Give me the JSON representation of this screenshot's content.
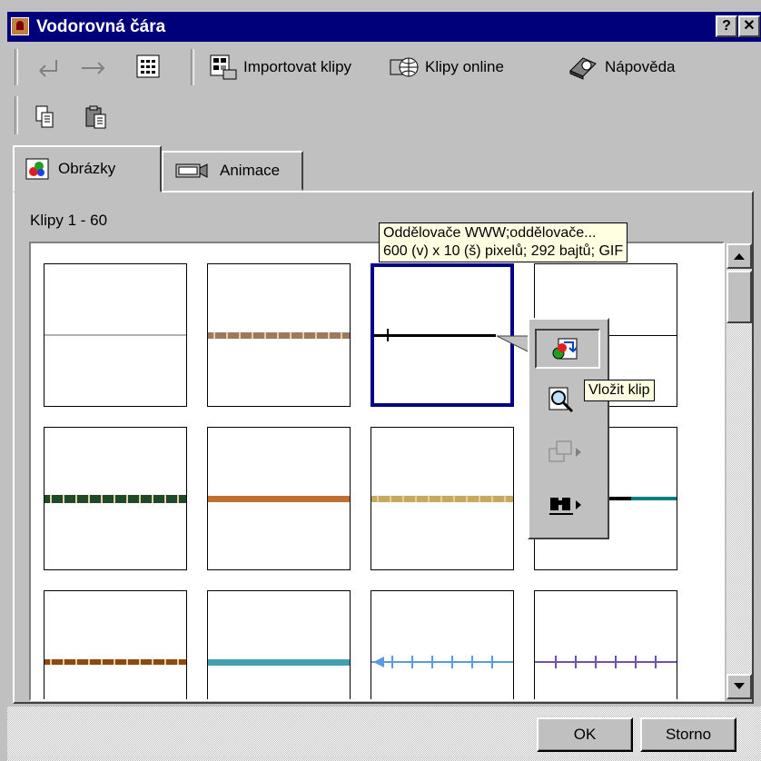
{
  "window": {
    "title": "Vodorovná čára",
    "help_btn": "?",
    "close_btn": "✕"
  },
  "toolbar": {
    "back_icon": "back-arrow-icon",
    "forward_icon": "forward-arrow-icon",
    "import_label": "Importovat klipy",
    "online_label": "Klipy online",
    "help_label": "Nápověda"
  },
  "tabs": [
    {
      "label": "Obrázky",
      "icon": "pictures-icon",
      "active": true
    },
    {
      "label": "Animace",
      "icon": "camera-icon",
      "active": false
    }
  ],
  "clip_count": "Klipy 1 - 60",
  "tooltip_info": {
    "line1": "Oddělovače WWW;oddělovače...",
    "line2": "600 (v) x 10 (š) pixelů; 292 bajtů; GIF"
  },
  "tooltip_insert": "Vložit klip",
  "thumbnails": [
    {
      "color": "#b0b0b0",
      "style": "plain",
      "thickness": 2
    },
    {
      "color": "#a07860",
      "style": "textured",
      "thickness": 7
    },
    {
      "color": "#000000",
      "style": "tick",
      "thickness": 3
    },
    {
      "color": "#000000",
      "style": "plain",
      "thickness": 1
    },
    {
      "color": "#1e4a2a",
      "style": "textured",
      "thickness": 9
    },
    {
      "color": "#c07030",
      "style": "plain",
      "thickness": 7
    },
    {
      "color": "#c8a860",
      "style": "textured",
      "thickness": 7
    },
    {
      "color": "#008080",
      "style": "teal",
      "thickness": 4
    },
    {
      "color": "#8a4a10",
      "style": "textured",
      "thickness": 6
    },
    {
      "color": "#40a0b0",
      "style": "plain",
      "thickness": 7
    },
    {
      "color": "#5a9ae0",
      "style": "arrow",
      "thickness": 2
    },
    {
      "color": "#7050b0",
      "style": "ticks",
      "thickness": 2
    }
  ],
  "buttons": {
    "ok": "OK",
    "cancel": "Storno"
  },
  "colors": {
    "title_bar": "#00007b",
    "selection": "#00008b",
    "tooltip_bg": "#ffffe1"
  }
}
